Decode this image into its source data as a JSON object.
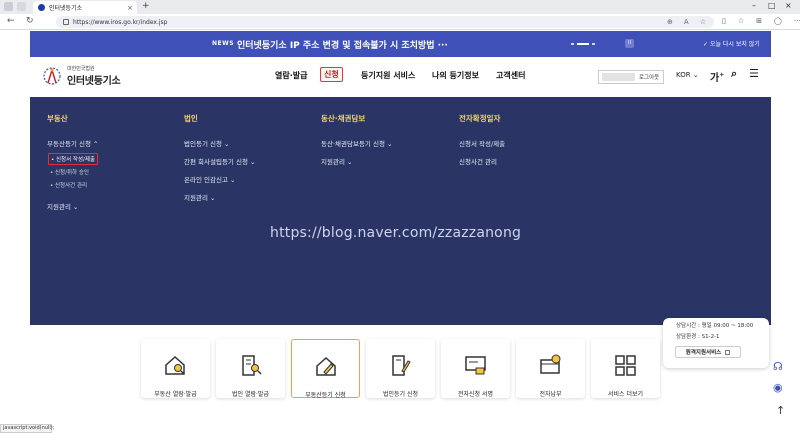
{
  "browser": {
    "tab_title": "인터넷등기소",
    "url": "https://www.iros.go.kr/index.jsp"
  },
  "notice": {
    "tag": "NEWS",
    "message": "인터넷등기소 IP 주소 변경 및 접속불가 시 조치방법 ···",
    "close_label": "오늘 다시 보지 않기"
  },
  "header": {
    "logo_sub": "대한민국법원",
    "logo_main": "인터넷등기소",
    "nav": [
      "열람·발급",
      "신청",
      "등기지원 서비스",
      "나의 등기정보",
      "고객센터"
    ],
    "logout_label": "로그아웃",
    "lang": "KOR",
    "font_size_label": "가"
  },
  "mega_menu": {
    "columns": [
      {
        "title": "부동산",
        "items": [
          "부동산등기 신청",
          "지원관리"
        ],
        "subitems": [
          "신청서 작성/제출",
          "신청/취하 승인",
          "신청사건 관리"
        ]
      },
      {
        "title": "법인",
        "items": [
          "법인등기 신청",
          "간편 회사설립등기 신청",
          "온라인 인감신고",
          "지원관리"
        ]
      },
      {
        "title": "동산·채권담보",
        "items": [
          "동산·채권담보등기 신청",
          "지원관리"
        ]
      },
      {
        "title": "전자확정일자",
        "items": [
          "신청서 작성/제출",
          "신청사건 관리"
        ]
      }
    ]
  },
  "watermark": "https://blog.naver.com/zzazzanong",
  "float_panel": {
    "line1": "상담시간 : 평일 09:00 ~ 18:00",
    "line2": "상담환경 : S1-2-1",
    "button": "원격지원서비스"
  },
  "tiles": [
    "부동산 열람·발급",
    "법인 열람·발급",
    "부동산등기 신청",
    "법인등기 신청",
    "전자신청 서명",
    "전자납부",
    "서비스 더보기"
  ],
  "status_text": "javascript:void(null);",
  "colors": {
    "brand_blue": "#3f50b8",
    "menu_bg": "#2a3566",
    "menu_heading": "#f1d36b",
    "highlight_red": "#e03030",
    "tile_selected": "#f0a040"
  }
}
